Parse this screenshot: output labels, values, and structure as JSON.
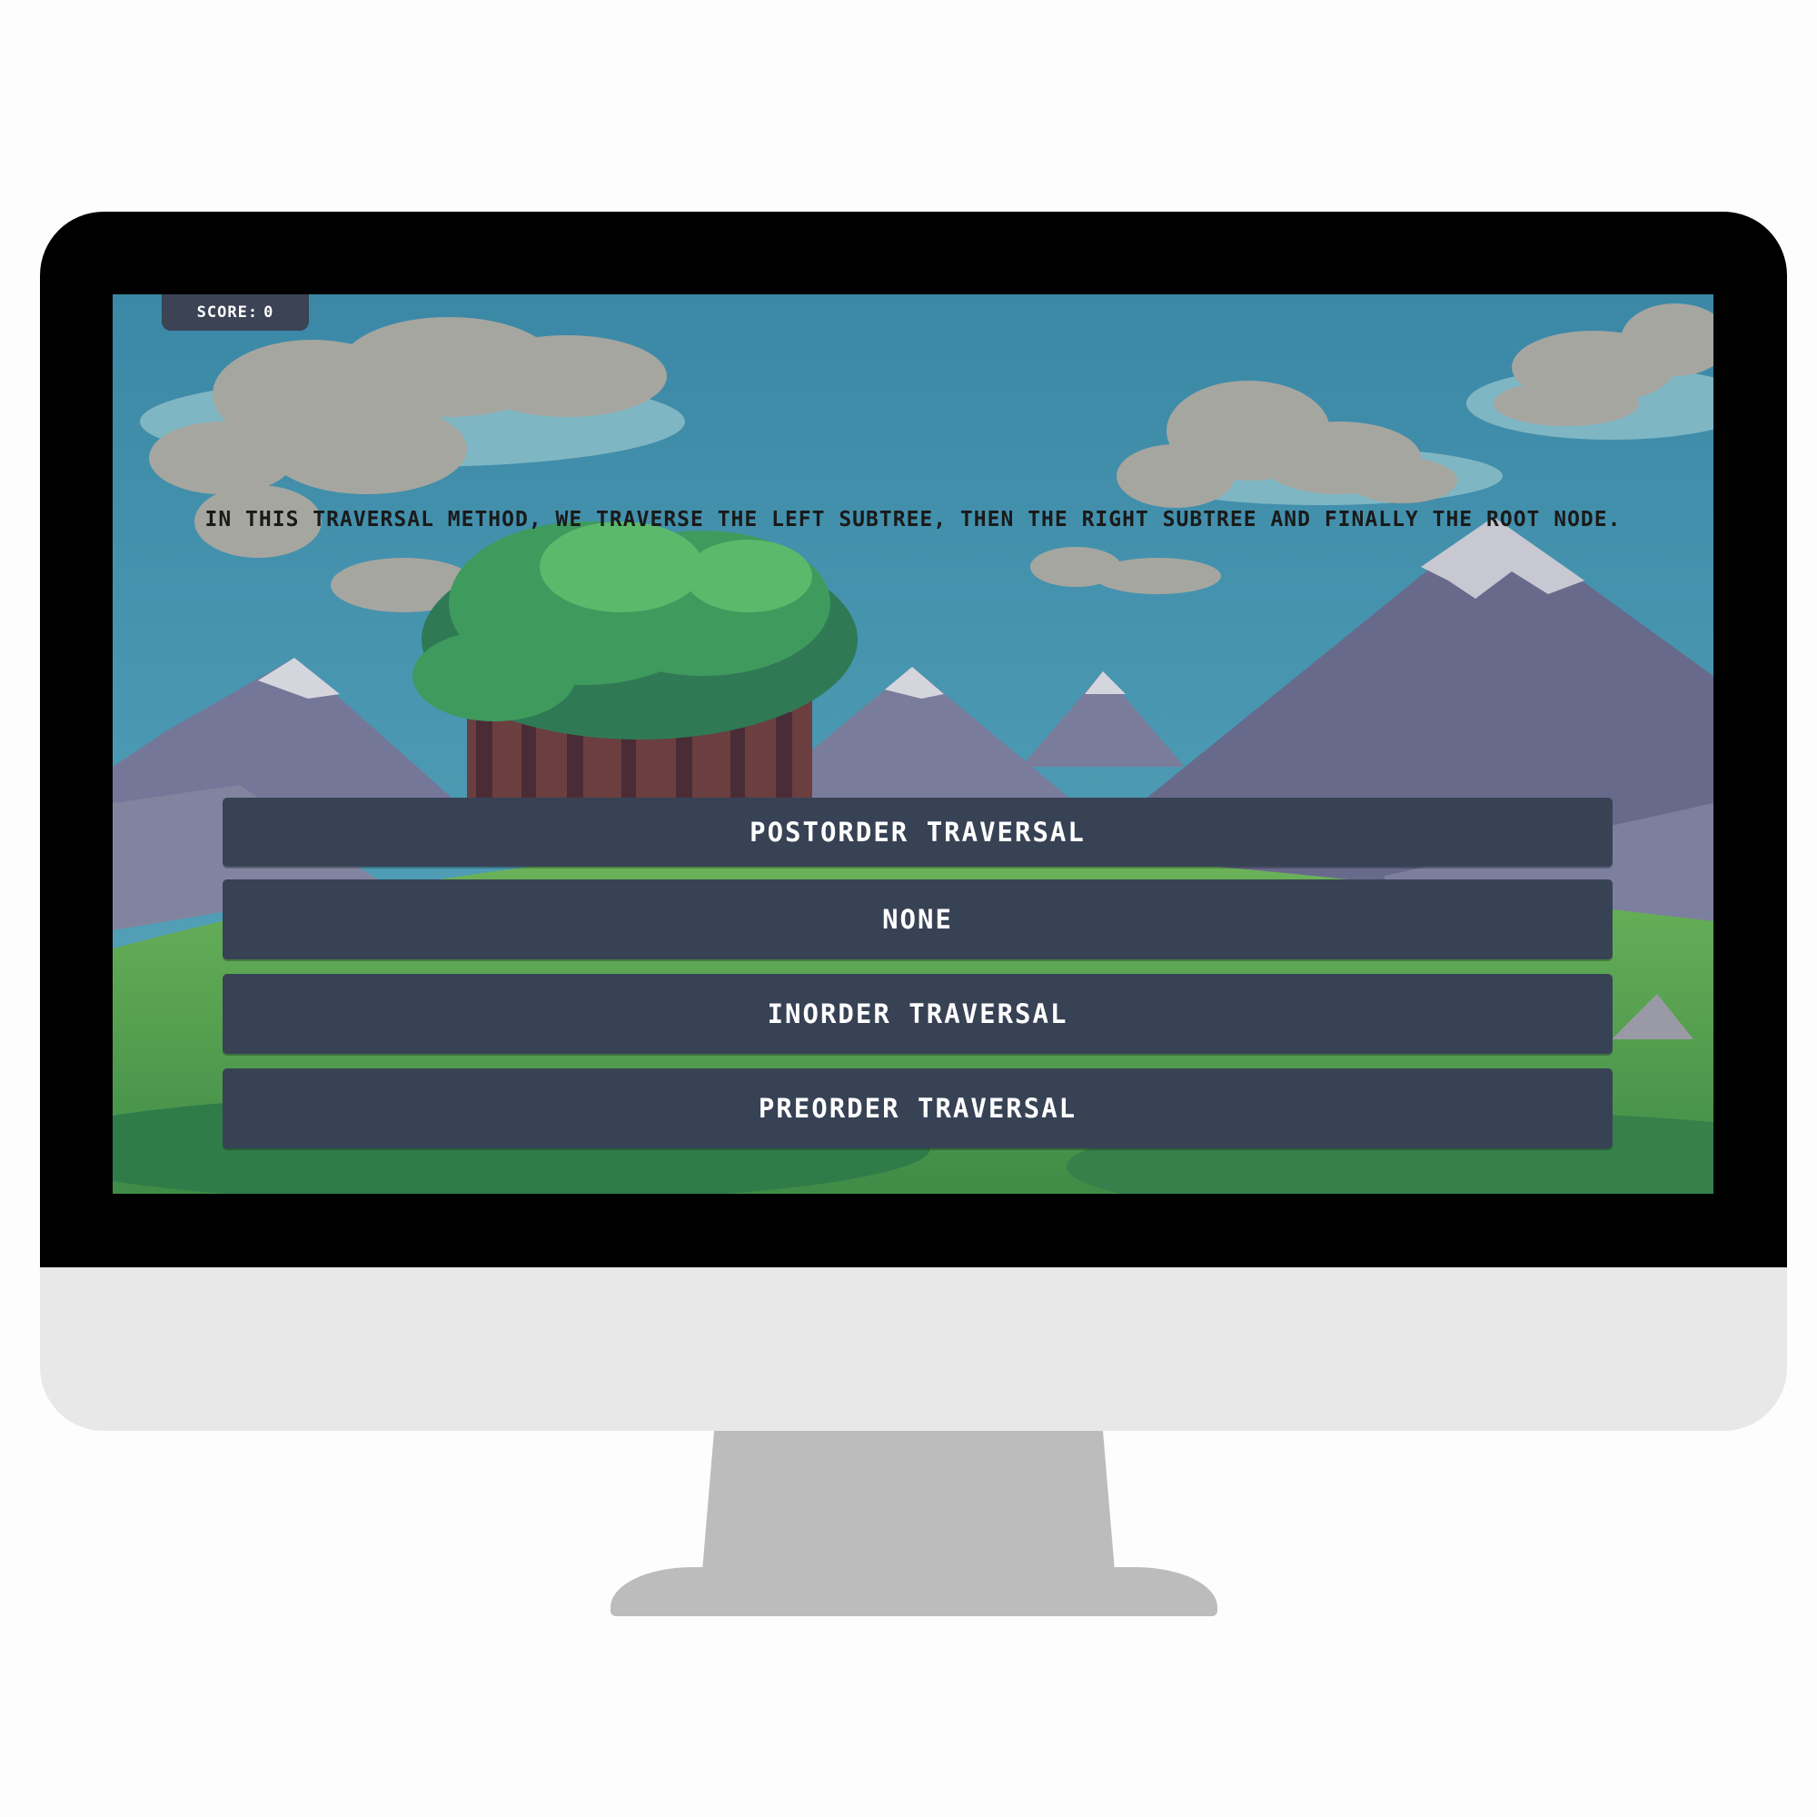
{
  "game": {
    "score_label": "SCORE:",
    "score_value": "0",
    "question": "IN THIS TRAVERSAL METHOD, WE TRAVERSE THE LEFT SUBTREE, THEN THE RIGHT SUBTREE AND FINALLY THE ROOT NODE.",
    "answers": [
      {
        "label": "POSTORDER TRAVERSAL"
      },
      {
        "label": "NONE"
      },
      {
        "label": "INORDER TRAVERSAL"
      },
      {
        "label": "PREORDER TRAVERSAL"
      }
    ]
  },
  "colors": {
    "sky": "#3c8aa8",
    "button": "#384255",
    "badge": "#3b4355",
    "grass": "#4f9a4e",
    "mountain": "#6a6c8e",
    "snow": "#c8c8d2",
    "cloud": "#a6a6a0",
    "bezel": "#000000",
    "chin": "#e8e8e8",
    "stand": "#bcbcbc"
  },
  "icons": [
    "monitor-frame"
  ]
}
